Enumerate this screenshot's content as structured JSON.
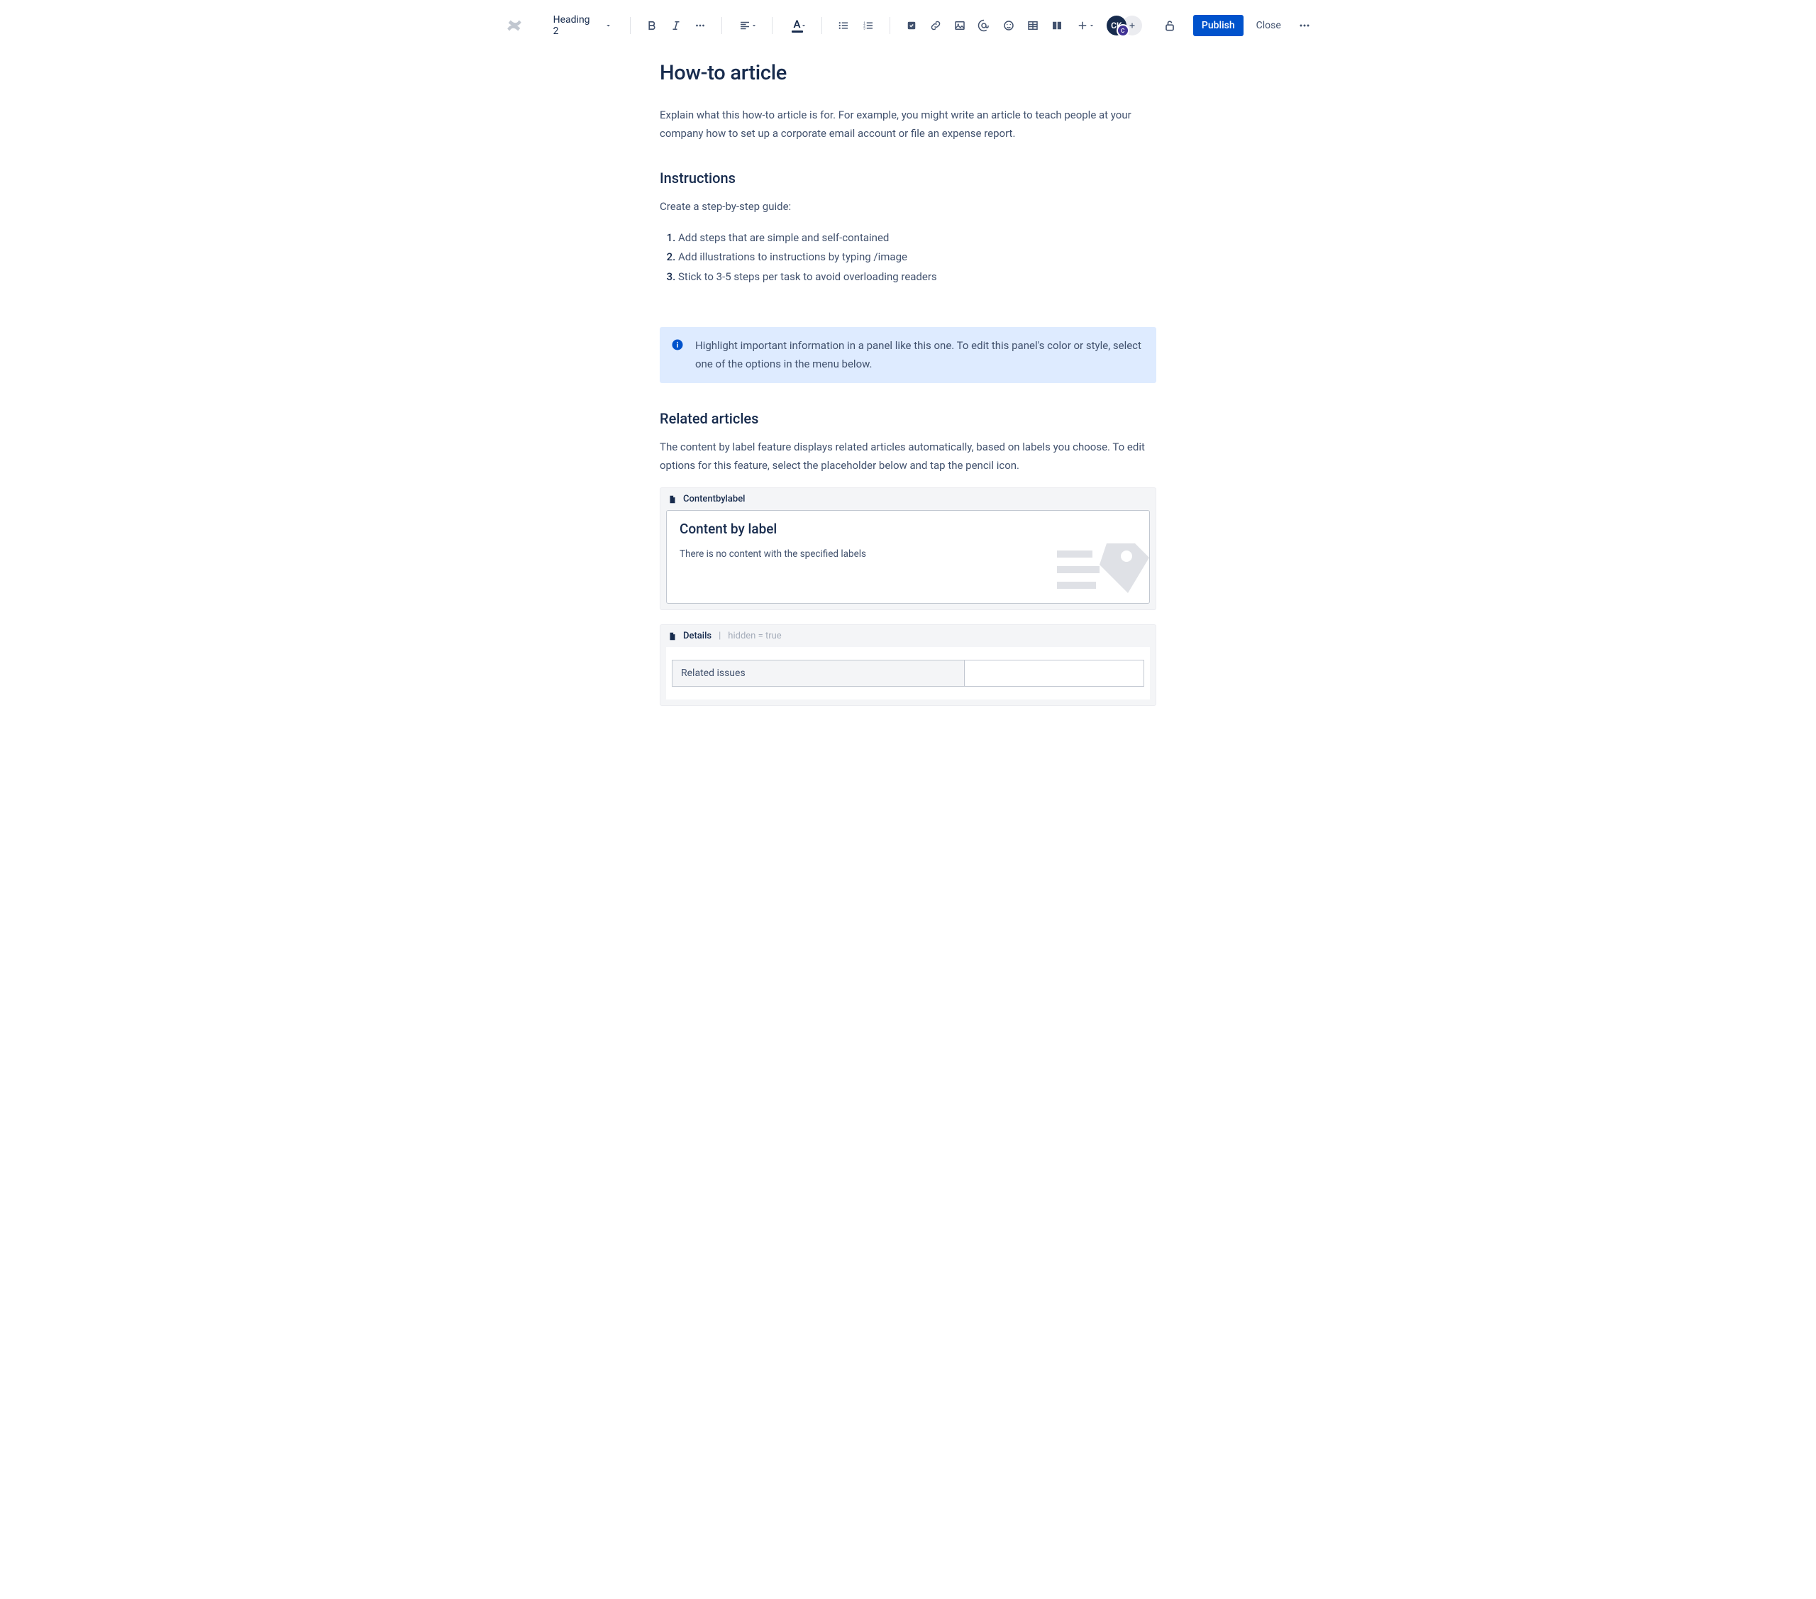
{
  "toolbar": {
    "heading_style": "Heading 2",
    "text_color_letter": "A",
    "avatar_initials": "CK",
    "avatar_badge": "C",
    "publish_label": "Publish",
    "close_label": "Close"
  },
  "page": {
    "title": "How-to article",
    "intro": "Explain what this how-to article is for. For example, you might write an article to teach people at your company how to set up a corporate email account or file an expense report.",
    "instructions_heading": "Instructions",
    "instructions_lead": "Create a step-by-step guide:",
    "steps": [
      "Add steps that are simple and self-contained",
      "Add illustrations to instructions by typing /image",
      "Stick to 3-5 steps per task to avoid overloading readers"
    ],
    "panel_text": "Highlight important information in a panel like this one. To edit this panel's color or style, select one of the options in the menu below.",
    "related_heading": "Related articles",
    "related_text": "The content by label feature displays related articles automatically, based on labels you choose. To edit options for this feature, select the placeholder below and tap the pencil icon."
  },
  "macros": {
    "content_by_label": {
      "header": "Contentbylabel",
      "title": "Content by label",
      "empty_msg": "There is no content with the specified labels"
    },
    "details": {
      "header": "Details",
      "meta": "hidden = true",
      "row_label": "Related issues",
      "row_value": ""
    }
  }
}
